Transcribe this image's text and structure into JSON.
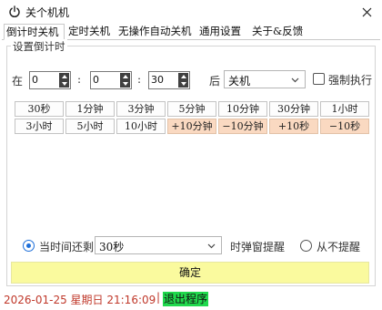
{
  "window": {
    "title": "关个机机",
    "close_label": "✕"
  },
  "tabs": [
    {
      "label": "倒计时关机",
      "active": true
    },
    {
      "label": "定时关机",
      "active": false
    },
    {
      "label": "无操作自动关机",
      "active": false
    },
    {
      "label": "通用设置",
      "active": false
    },
    {
      "label": "关于&反馈",
      "active": false
    }
  ],
  "countdown": {
    "group_label": "设置倒计时",
    "in_label": "在",
    "hours": "0",
    "minutes": "0",
    "seconds": "30",
    "separator": ":",
    "after_label": "后",
    "action_value": "关机",
    "force_label": "强制执行",
    "force_checked": false
  },
  "quick_buttons": {
    "row1": [
      "30秒",
      "1分钟",
      "3分钟",
      "5分钟",
      "10分钟",
      "30分钟",
      "1小时"
    ],
    "row2": [
      "3小时",
      "5小时",
      "10小时",
      "+10分钟",
      "−10分钟",
      "+10秒",
      "−10秒"
    ]
  },
  "reminder": {
    "option_remaining": "当时间还剩",
    "remaining_value": "30秒",
    "popup_label": "时弹窗提醒",
    "option_never": "从不提醒",
    "selected": "remaining"
  },
  "confirm_label": "确定",
  "status": {
    "datetime": "2026-01-25 星期日 21:16:09",
    "separator": "|",
    "exit_label": "退出程序"
  },
  "colors": {
    "adjust_button_bg": "#fad9c1",
    "confirm_bg": "#fafa9e",
    "status_text": "#c0392b",
    "exit_bg": "#1fd94d",
    "radio_accent": "#1e6fd9"
  }
}
